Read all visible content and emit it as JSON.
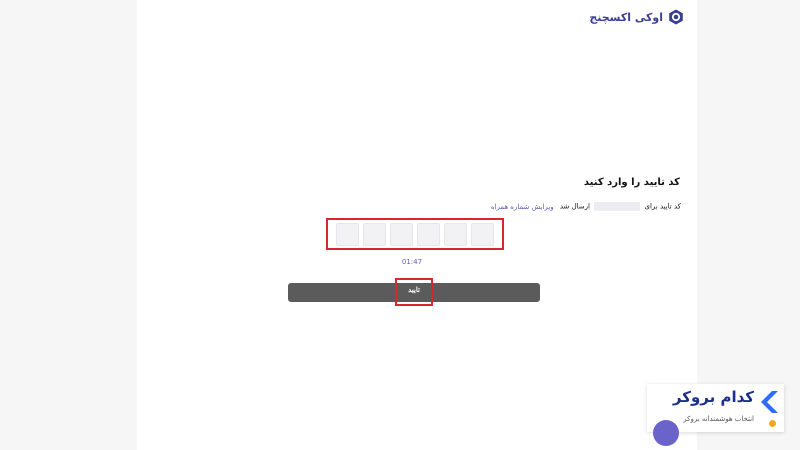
{
  "header": {
    "brand_name": "اوکی اکسچنج",
    "brand_icon": "hexagon-logo-icon"
  },
  "verify": {
    "title": "کد تایید را وارد کنید",
    "subtitle_prefix": "کد تایید برای",
    "subtitle_suffix": "ارسال شد",
    "edit_link": "ویرایش شماره همراه",
    "otp_cells": 6,
    "timer": "01:47",
    "confirm_label": "تایید"
  },
  "badge": {
    "title": "کدام بروکر",
    "subtitle": "انتخاب هوشمندانه بروکر",
    "icon": "chevron-left-icon",
    "accent": "#2f6df6"
  },
  "colors": {
    "highlight": "#d6262e",
    "link": "#5a5fb4",
    "button": "#5b5b5b",
    "brand": "#3a3f8f"
  }
}
